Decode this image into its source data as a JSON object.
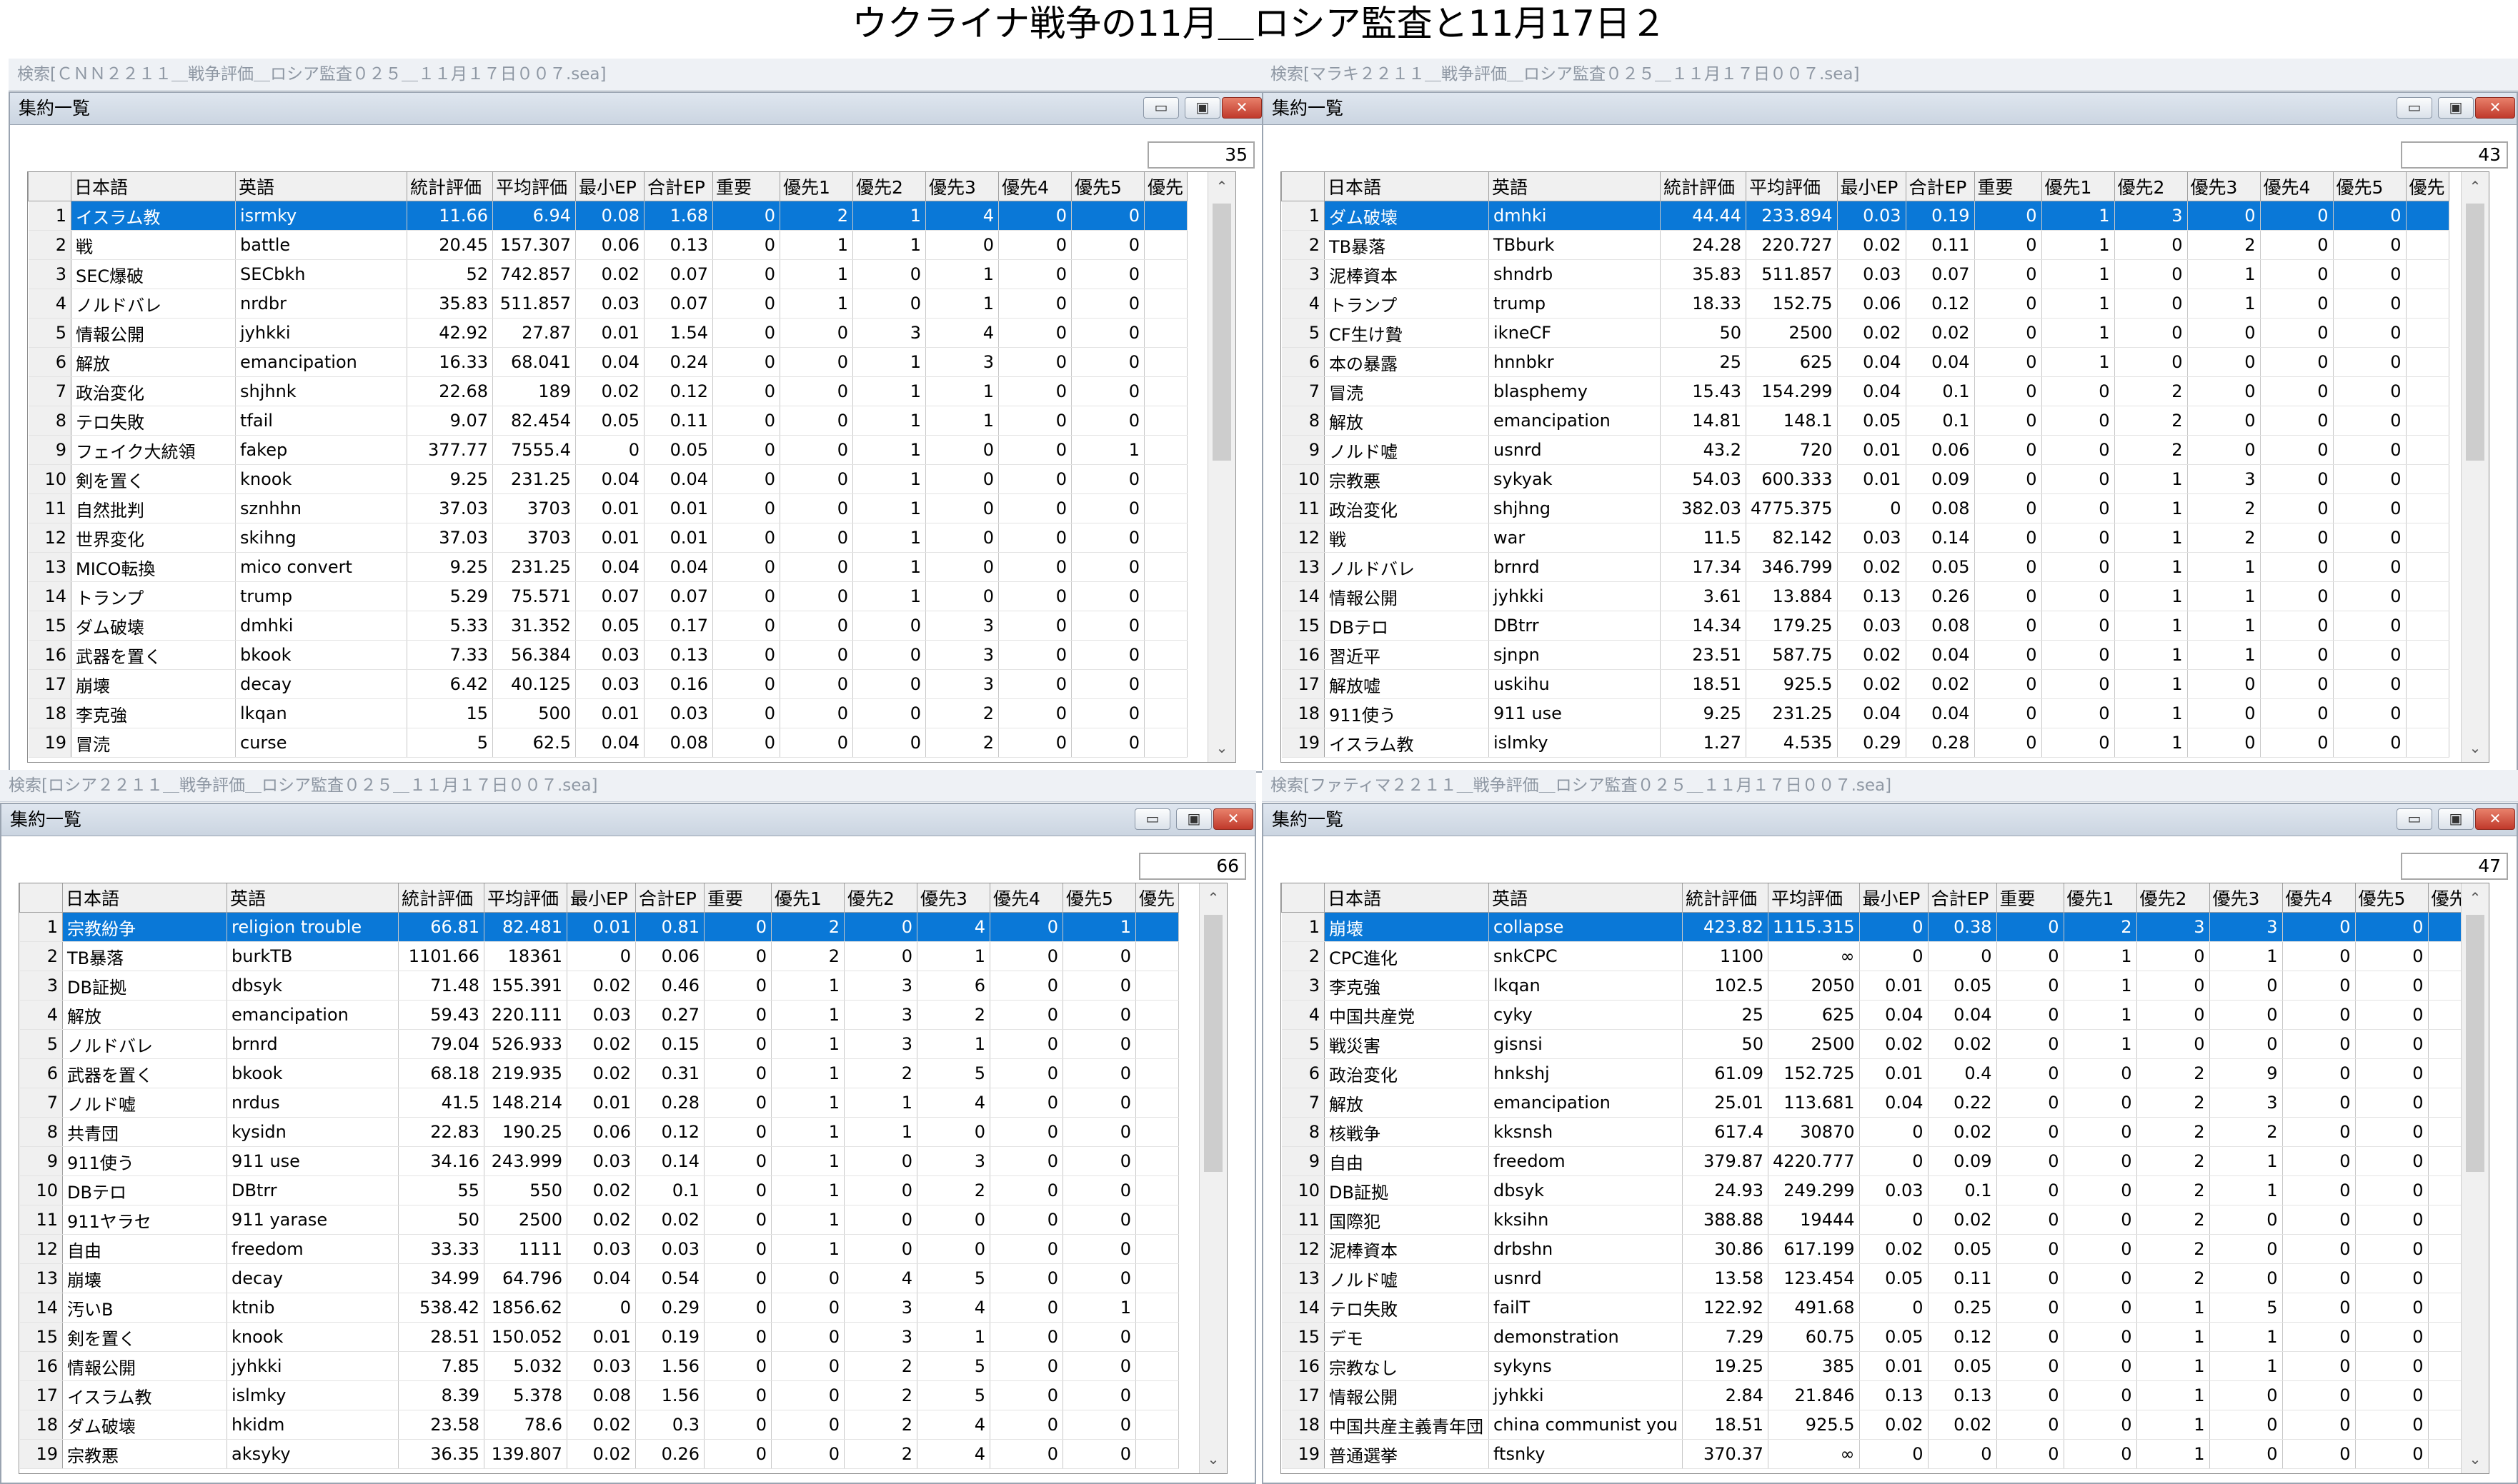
{
  "page_title": "ウクライナ戦争の11月＿ロシア監査と11月17日２",
  "window": {
    "title": "集約一覧",
    "min_label": "▭",
    "max_label": "▣",
    "close_label": "✕"
  },
  "columns": [
    "日本語",
    "英語",
    "統計評価",
    "平均評価",
    "最小EP",
    "合計EP",
    "重要",
    "優先1",
    "優先2",
    "優先3",
    "優先4",
    "優先5",
    "優先"
  ],
  "panels": [
    {
      "search_title": "検索[ＣＮＮ２２１１＿戦争評価＿ロシア監査０２５＿１１月１７日００７.sea]",
      "count": "35",
      "rows": [
        [
          "イスラム教",
          "isrmky",
          "11.66",
          "6.94",
          "0.08",
          "1.68",
          "0",
          "2",
          "1",
          "4",
          "0",
          "0"
        ],
        [
          "戦",
          "battle",
          "20.45",
          "157.307",
          "0.06",
          "0.13",
          "0",
          "1",
          "1",
          "0",
          "0",
          "0"
        ],
        [
          "SEC爆破",
          "SECbkh",
          "52",
          "742.857",
          "0.02",
          "0.07",
          "0",
          "1",
          "0",
          "1",
          "0",
          "0"
        ],
        [
          "ノルドバレ",
          "nrdbr",
          "35.83",
          "511.857",
          "0.03",
          "0.07",
          "0",
          "1",
          "0",
          "1",
          "0",
          "0"
        ],
        [
          "情報公開",
          "jyhkki",
          "42.92",
          "27.87",
          "0.01",
          "1.54",
          "0",
          "0",
          "3",
          "4",
          "0",
          "0"
        ],
        [
          "解放",
          "emancipation",
          "16.33",
          "68.041",
          "0.04",
          "0.24",
          "0",
          "0",
          "1",
          "3",
          "0",
          "0"
        ],
        [
          "政治変化",
          "shjhnk",
          "22.68",
          "189",
          "0.02",
          "0.12",
          "0",
          "0",
          "1",
          "1",
          "0",
          "0"
        ],
        [
          "テロ失敗",
          "tfail",
          "9.07",
          "82.454",
          "0.05",
          "0.11",
          "0",
          "0",
          "1",
          "1",
          "0",
          "0"
        ],
        [
          "フェイク大統領",
          "fakep",
          "377.77",
          "7555.4",
          "0",
          "0.05",
          "0",
          "0",
          "1",
          "0",
          "0",
          "1"
        ],
        [
          "剣を置く",
          "knook",
          "9.25",
          "231.25",
          "0.04",
          "0.04",
          "0",
          "0",
          "1",
          "0",
          "0",
          "0"
        ],
        [
          "自然批判",
          "sznhhn",
          "37.03",
          "3703",
          "0.01",
          "0.01",
          "0",
          "0",
          "1",
          "0",
          "0",
          "0"
        ],
        [
          "世界変化",
          "skihng",
          "37.03",
          "3703",
          "0.01",
          "0.01",
          "0",
          "0",
          "1",
          "0",
          "0",
          "0"
        ],
        [
          "MICO転換",
          "mico convert",
          "9.25",
          "231.25",
          "0.04",
          "0.04",
          "0",
          "0",
          "1",
          "0",
          "0",
          "0"
        ],
        [
          "トランプ",
          "trump",
          "5.29",
          "75.571",
          "0.07",
          "0.07",
          "0",
          "0",
          "1",
          "0",
          "0",
          "0"
        ],
        [
          "ダム破壊",
          "dmhki",
          "5.33",
          "31.352",
          "0.05",
          "0.17",
          "0",
          "0",
          "0",
          "3",
          "0",
          "0"
        ],
        [
          "武器を置く",
          "bkook",
          "7.33",
          "56.384",
          "0.03",
          "0.13",
          "0",
          "0",
          "0",
          "3",
          "0",
          "0"
        ],
        [
          "崩壊",
          "decay",
          "6.42",
          "40.125",
          "0.03",
          "0.16",
          "0",
          "0",
          "0",
          "3",
          "0",
          "0"
        ],
        [
          "李克強",
          "lkqan",
          "15",
          "500",
          "0.01",
          "0.03",
          "0",
          "0",
          "0",
          "2",
          "0",
          "0"
        ],
        [
          "冒涜",
          "curse",
          "5",
          "62.5",
          "0.04",
          "0.08",
          "0",
          "0",
          "0",
          "2",
          "0",
          "0"
        ]
      ]
    },
    {
      "search_title": "検索[マラキ２２１１＿戦争評価＿ロシア監査０２５＿１１月１７日００７.sea]",
      "count": "43",
      "rows": [
        [
          "ダム破壊",
          "dmhki",
          "44.44",
          "233.894",
          "0.03",
          "0.19",
          "0",
          "1",
          "3",
          "0",
          "0",
          "0"
        ],
        [
          "TB暴落",
          "TBburk",
          "24.28",
          "220.727",
          "0.02",
          "0.11",
          "0",
          "1",
          "0",
          "2",
          "0",
          "0"
        ],
        [
          "泥棒資本",
          "shndrb",
          "35.83",
          "511.857",
          "0.03",
          "0.07",
          "0",
          "1",
          "0",
          "1",
          "0",
          "0"
        ],
        [
          "トランプ",
          "trump",
          "18.33",
          "152.75",
          "0.06",
          "0.12",
          "0",
          "1",
          "0",
          "1",
          "0",
          "0"
        ],
        [
          "CF生け贄",
          "ikneCF",
          "50",
          "2500",
          "0.02",
          "0.02",
          "0",
          "1",
          "0",
          "0",
          "0",
          "0"
        ],
        [
          "本の暴露",
          "hnnbkr",
          "25",
          "625",
          "0.04",
          "0.04",
          "0",
          "1",
          "0",
          "0",
          "0",
          "0"
        ],
        [
          "冒涜",
          "blasphemy",
          "15.43",
          "154.299",
          "0.04",
          "0.1",
          "0",
          "0",
          "2",
          "0",
          "0",
          "0"
        ],
        [
          "解放",
          "emancipation",
          "14.81",
          "148.1",
          "0.05",
          "0.1",
          "0",
          "0",
          "2",
          "0",
          "0",
          "0"
        ],
        [
          "ノルド嘘",
          "usnrd",
          "43.2",
          "720",
          "0.01",
          "0.06",
          "0",
          "0",
          "2",
          "0",
          "0",
          "0"
        ],
        [
          "宗教悪",
          "sykyak",
          "54.03",
          "600.333",
          "0.01",
          "0.09",
          "0",
          "0",
          "1",
          "3",
          "0",
          "0"
        ],
        [
          "政治変化",
          "shjhng",
          "382.03",
          "4775.375",
          "0",
          "0.08",
          "0",
          "0",
          "1",
          "2",
          "0",
          "0"
        ],
        [
          "戦",
          "war",
          "11.5",
          "82.142",
          "0.03",
          "0.14",
          "0",
          "0",
          "1",
          "2",
          "0",
          "0"
        ],
        [
          "ノルドバレ",
          "brnrd",
          "17.34",
          "346.799",
          "0.02",
          "0.05",
          "0",
          "0",
          "1",
          "1",
          "0",
          "0"
        ],
        [
          "情報公開",
          "jyhkki",
          "3.61",
          "13.884",
          "0.13",
          "0.26",
          "0",
          "0",
          "1",
          "1",
          "0",
          "0"
        ],
        [
          "DBテロ",
          "DBtrr",
          "14.34",
          "179.25",
          "0.03",
          "0.08",
          "0",
          "0",
          "1",
          "1",
          "0",
          "0"
        ],
        [
          "習近平",
          "sjnpn",
          "23.51",
          "587.75",
          "0.02",
          "0.04",
          "0",
          "0",
          "1",
          "1",
          "0",
          "0"
        ],
        [
          "解放嘘",
          "uskihu",
          "18.51",
          "925.5",
          "0.02",
          "0.02",
          "0",
          "0",
          "1",
          "0",
          "0",
          "0"
        ],
        [
          "911使う",
          "911 use",
          "9.25",
          "231.25",
          "0.04",
          "0.04",
          "0",
          "0",
          "1",
          "0",
          "0",
          "0"
        ],
        [
          "イスラム教",
          "islmky",
          "1.27",
          "4.535",
          "0.29",
          "0.28",
          "0",
          "0",
          "1",
          "0",
          "0",
          "0"
        ]
      ]
    },
    {
      "search_title": "検索[ロシア２２１１＿戦争評価＿ロシア監査０２５＿１１月１７日００７.sea]",
      "count": "66",
      "rows": [
        [
          "宗教紛争",
          "religion trouble",
          "66.81",
          "82.481",
          "0.01",
          "0.81",
          "0",
          "2",
          "0",
          "4",
          "0",
          "1"
        ],
        [
          "TB暴落",
          "burkTB",
          "1101.66",
          "18361",
          "0",
          "0.06",
          "0",
          "2",
          "0",
          "1",
          "0",
          "0"
        ],
        [
          "DB証拠",
          "dbsyk",
          "71.48",
          "155.391",
          "0.02",
          "0.46",
          "0",
          "1",
          "3",
          "6",
          "0",
          "0"
        ],
        [
          "解放",
          "emancipation",
          "59.43",
          "220.111",
          "0.03",
          "0.27",
          "0",
          "1",
          "3",
          "2",
          "0",
          "0"
        ],
        [
          "ノルドバレ",
          "brnrd",
          "79.04",
          "526.933",
          "0.02",
          "0.15",
          "0",
          "1",
          "3",
          "1",
          "0",
          "0"
        ],
        [
          "武器を置く",
          "bkook",
          "68.18",
          "219.935",
          "0.02",
          "0.31",
          "0",
          "1",
          "2",
          "5",
          "0",
          "0"
        ],
        [
          "ノルド嘘",
          "nrdus",
          "41.5",
          "148.214",
          "0.01",
          "0.28",
          "0",
          "1",
          "1",
          "4",
          "0",
          "0"
        ],
        [
          "共青団",
          "kysidn",
          "22.83",
          "190.25",
          "0.06",
          "0.12",
          "0",
          "1",
          "1",
          "0",
          "0",
          "0"
        ],
        [
          "911使う",
          "911 use",
          "34.16",
          "243.999",
          "0.03",
          "0.14",
          "0",
          "1",
          "0",
          "3",
          "0",
          "0"
        ],
        [
          "DBテロ",
          "DBtrr",
          "55",
          "550",
          "0.02",
          "0.1",
          "0",
          "1",
          "0",
          "2",
          "0",
          "0"
        ],
        [
          "911ヤラセ",
          "911 yarase",
          "50",
          "2500",
          "0.02",
          "0.02",
          "0",
          "1",
          "0",
          "0",
          "0",
          "0"
        ],
        [
          "自由",
          "freedom",
          "33.33",
          "1111",
          "0.03",
          "0.03",
          "0",
          "1",
          "0",
          "0",
          "0",
          "0"
        ],
        [
          "崩壊",
          "decay",
          "34.99",
          "64.796",
          "0.04",
          "0.54",
          "0",
          "0",
          "4",
          "5",
          "0",
          "0"
        ],
        [
          "汚いB",
          "ktnib",
          "538.42",
          "1856.62",
          "0",
          "0.29",
          "0",
          "0",
          "3",
          "4",
          "0",
          "1"
        ],
        [
          "剣を置く",
          "knook",
          "28.51",
          "150.052",
          "0.01",
          "0.19",
          "0",
          "0",
          "3",
          "1",
          "0",
          "0"
        ],
        [
          "情報公開",
          "jyhkki",
          "7.85",
          "5.032",
          "0.03",
          "1.56",
          "0",
          "0",
          "2",
          "5",
          "0",
          "0"
        ],
        [
          "イスラム教",
          "islmky",
          "8.39",
          "5.378",
          "0.08",
          "1.56",
          "0",
          "0",
          "2",
          "5",
          "0",
          "0"
        ],
        [
          "ダム破壊",
          "hkidm",
          "23.58",
          "78.6",
          "0.02",
          "0.3",
          "0",
          "0",
          "2",
          "4",
          "0",
          "0"
        ],
        [
          "宗教悪",
          "aksyky",
          "36.35",
          "139.807",
          "0.02",
          "0.26",
          "0",
          "0",
          "2",
          "4",
          "0",
          "0"
        ]
      ]
    },
    {
      "search_title": "検索[ファティマ２２１１＿戦争評価＿ロシア監査０２５＿１１月１７日００７.sea]",
      "count": "47",
      "rows": [
        [
          "崩壊",
          "collapse",
          "423.82",
          "1115.315",
          "0",
          "0.38",
          "0",
          "2",
          "3",
          "3",
          "0",
          "0"
        ],
        [
          "CPC進化",
          "snkCPC",
          "1100",
          "∞",
          "0",
          "0",
          "0",
          "1",
          "0",
          "1",
          "0",
          "0"
        ],
        [
          "李克強",
          "lkqan",
          "102.5",
          "2050",
          "0.01",
          "0.05",
          "0",
          "1",
          "0",
          "0",
          "0",
          "0"
        ],
        [
          "中国共産党",
          "cyky",
          "25",
          "625",
          "0.04",
          "0.04",
          "0",
          "1",
          "0",
          "0",
          "0",
          "0"
        ],
        [
          "戦災害",
          "gisnsi",
          "50",
          "2500",
          "0.02",
          "0.02",
          "0",
          "1",
          "0",
          "0",
          "0",
          "0"
        ],
        [
          "政治変化",
          "hnkshj",
          "61.09",
          "152.725",
          "0.01",
          "0.4",
          "0",
          "0",
          "2",
          "9",
          "0",
          "0"
        ],
        [
          "解放",
          "emancipation",
          "25.01",
          "113.681",
          "0.04",
          "0.22",
          "0",
          "0",
          "2",
          "3",
          "0",
          "0"
        ],
        [
          "核戦争",
          "kksnsh",
          "617.4",
          "30870",
          "0",
          "0.02",
          "0",
          "0",
          "2",
          "2",
          "0",
          "0"
        ],
        [
          "自由",
          "freedom",
          "379.87",
          "4220.777",
          "0",
          "0.09",
          "0",
          "0",
          "2",
          "1",
          "0",
          "0"
        ],
        [
          "DB証拠",
          "dbsyk",
          "24.93",
          "249.299",
          "0.03",
          "0.1",
          "0",
          "0",
          "2",
          "1",
          "0",
          "0"
        ],
        [
          "国際犯",
          "kksihn",
          "388.88",
          "19444",
          "0",
          "0.02",
          "0",
          "0",
          "2",
          "0",
          "0",
          "0"
        ],
        [
          "泥棒資本",
          "drbshn",
          "30.86",
          "617.199",
          "0.02",
          "0.05",
          "0",
          "0",
          "2",
          "0",
          "0",
          "0"
        ],
        [
          "ノルド嘘",
          "usnrd",
          "13.58",
          "123.454",
          "0.05",
          "0.11",
          "0",
          "0",
          "2",
          "0",
          "0",
          "0"
        ],
        [
          "テロ失敗",
          "failT",
          "122.92",
          "491.68",
          "0",
          "0.25",
          "0",
          "0",
          "1",
          "5",
          "0",
          "0"
        ],
        [
          "デモ",
          "demonstration",
          "7.29",
          "60.75",
          "0.05",
          "0.12",
          "0",
          "0",
          "1",
          "1",
          "0",
          "0"
        ],
        [
          "宗教なし",
          "sykyns",
          "19.25",
          "385",
          "0.01",
          "0.05",
          "0",
          "0",
          "1",
          "1",
          "0",
          "0"
        ],
        [
          "情報公開",
          "jyhkki",
          "2.84",
          "21.846",
          "0.13",
          "0.13",
          "0",
          "0",
          "1",
          "0",
          "0",
          "0"
        ],
        [
          "中国共産主義青年団",
          "china communist you",
          "18.51",
          "925.5",
          "0.02",
          "0.02",
          "0",
          "0",
          "1",
          "0",
          "0",
          "0"
        ],
        [
          "普通選挙",
          "ftsnky",
          "370.37",
          "∞",
          "0",
          "0",
          "0",
          "0",
          "1",
          "0",
          "0",
          "0"
        ]
      ]
    }
  ]
}
